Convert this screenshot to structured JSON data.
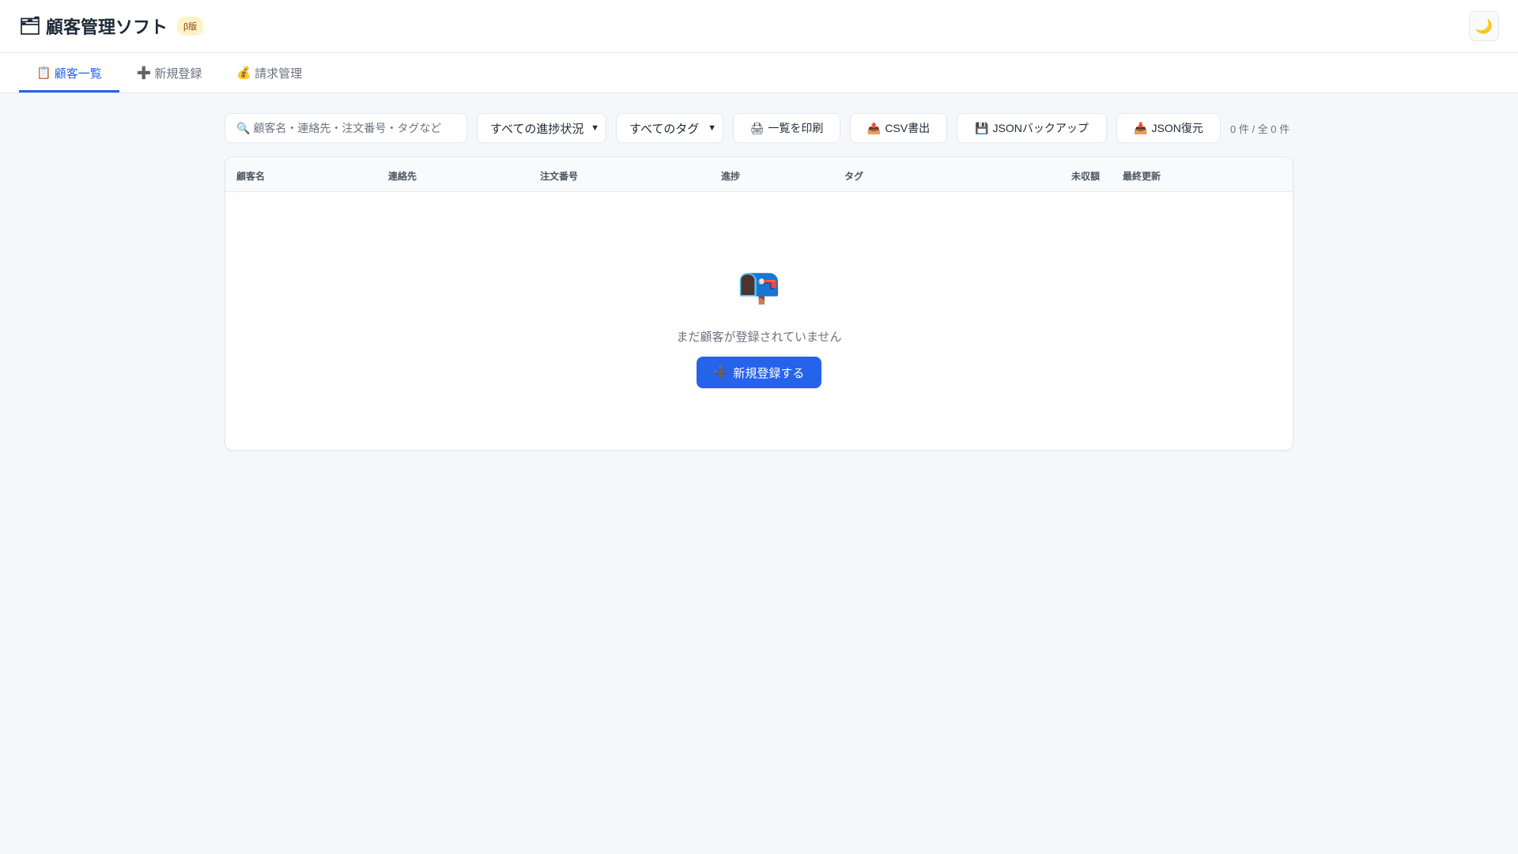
{
  "header": {
    "icon": "🗂",
    "title": "顧客管理ソフト",
    "badge": "β版",
    "theme_icon": "🌙"
  },
  "tabs": [
    {
      "icon": "📋",
      "label": "顧客一覧"
    },
    {
      "icon": "➕",
      "label": "新規登録"
    },
    {
      "icon": "💰",
      "label": "請求管理"
    }
  ],
  "toolbar": {
    "search_icon": "🔍",
    "search_placeholder": "顧客名・連絡先・注文番号・タグなど",
    "status_filter": "すべての進捗状況",
    "tag_filter": "すべてのタグ",
    "print": {
      "icon": "🖨",
      "label": "一覧を印刷"
    },
    "csv": {
      "icon": "📤",
      "label": "CSV書出"
    },
    "backup": {
      "icon": "💾",
      "label": "JSONバックアップ"
    },
    "restore": {
      "icon": "📥",
      "label": "JSON復元"
    },
    "count": "0 件 / 全 0 件"
  },
  "table": {
    "columns": [
      "顧客名",
      "連絡先",
      "注文番号",
      "進捗",
      "タグ",
      "未収額",
      "最終更新"
    ],
    "empty_icon": "📭",
    "empty_text": "まだ顧客が登録されていません",
    "empty_button": {
      "icon": "➕",
      "label": "新規登録する"
    }
  }
}
